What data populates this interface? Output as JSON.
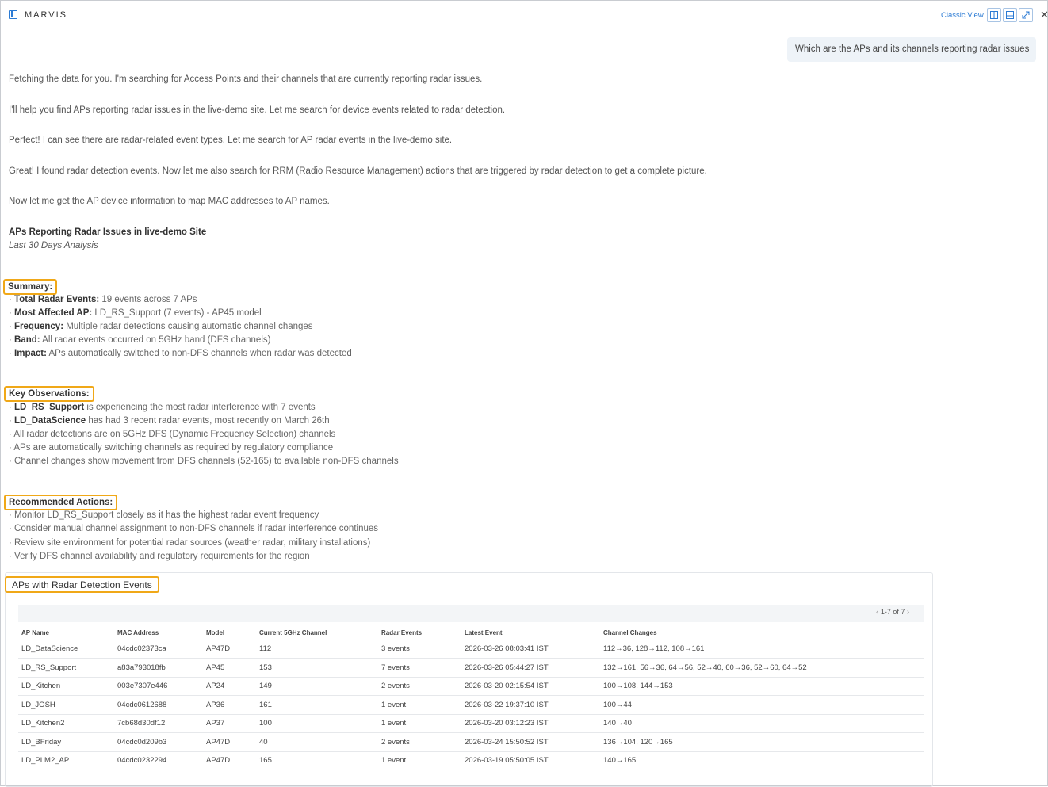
{
  "header": {
    "brand": "MARVIS",
    "classic_view": "Classic View"
  },
  "user_message": "Which are the APs and its channels reporting radar issues",
  "paragraphs": [
    "Fetching the data for you. I'm searching for Access Points and their channels that are currently reporting radar issues.",
    "I'll help you find APs reporting radar issues in the live-demo site. Let me search for device events related to radar detection.",
    "Perfect! I can see there are radar-related event types. Let me search for AP radar events in the live-demo site.",
    "Great! I found radar detection events. Now let me also search for RRM (Radio Resource Management) actions that are triggered by radar detection to get a complete picture.",
    "Now let me get the AP device information to map MAC addresses to AP names."
  ],
  "report": {
    "title": "APs Reporting Radar Issues in live-demo Site",
    "subtitle": "Last 30 Days Analysis"
  },
  "summary": {
    "title": "Summary:",
    "items": [
      {
        "label": "Total Radar Events:",
        "text": " 19 events across 7 APs"
      },
      {
        "label": "Most Affected AP:",
        "text": " LD_RS_Support (7 events) - AP45 model"
      },
      {
        "label": "Frequency:",
        "text": " Multiple radar detections causing automatic channel changes"
      },
      {
        "label": "Band:",
        "text": " All radar events occurred on 5GHz band (DFS channels)"
      },
      {
        "label": "Impact:",
        "text": " APs automatically switched to non-DFS channels when radar was detected"
      }
    ]
  },
  "observations": {
    "title": "Key Observations:",
    "items": [
      {
        "label": "LD_RS_Support",
        "text": " is experiencing the most radar interference with 7 events"
      },
      {
        "label": "LD_DataScience",
        "text": " has had 3 recent radar events, most recently on March 26th"
      },
      {
        "label": "",
        "text": "All radar detections are on 5GHz DFS (Dynamic Frequency Selection) channels"
      },
      {
        "label": "",
        "text": "APs are automatically switching channels as required by regulatory compliance"
      },
      {
        "label": "",
        "text": "Channel changes show movement from DFS channels (52-165) to available non-DFS channels"
      }
    ]
  },
  "actions": {
    "title": "Recommended Actions:",
    "items": [
      "Monitor LD_RS_Support closely as it has the highest radar event frequency",
      "Consider manual channel assignment to non-DFS channels if radar interference continues",
      "Review site environment for potential radar sources (weather radar, military installations)",
      "Verify DFS channel availability and regulatory requirements for the region"
    ]
  },
  "table": {
    "title": "APs with Radar Detection Events",
    "pager": "1-7 of 7",
    "columns": [
      "AP Name",
      "MAC Address",
      "Model",
      "Current 5GHz Channel",
      "Radar Events",
      "Latest Event",
      "Channel Changes"
    ],
    "rows": [
      [
        "LD_DataScience",
        "04cdc02373ca",
        "AP47D",
        "112",
        "3 events",
        "2026-03-26 08:03:41 IST",
        "112→36, 128→112, 108→161"
      ],
      [
        "LD_RS_Support",
        "a83a793018fb",
        "AP45",
        "153",
        "7 events",
        "2026-03-26 05:44:27 IST",
        "132→161, 56→36, 64→56, 52→40, 60→36, 52→60, 64→52"
      ],
      [
        "LD_Kitchen",
        "003e7307e446",
        "AP24",
        "149",
        "2 events",
        "2026-03-20 02:15:54 IST",
        "100→108, 144→153"
      ],
      [
        "LD_JOSH",
        "04cdc0612688",
        "AP36",
        "161",
        "1 event",
        "2026-03-22 19:37:10 IST",
        "100→44"
      ],
      [
        "LD_Kitchen2",
        "7cb68d30df12",
        "AP37",
        "100",
        "1 event",
        "2026-03-20 03:12:23 IST",
        "140→40"
      ],
      [
        "LD_BFriday",
        "04cdc0d209b3",
        "AP47D",
        "40",
        "2 events",
        "2026-03-24 15:50:52 IST",
        "136→104, 120→165"
      ],
      [
        "LD_PLM2_AP",
        "04cdc0232294",
        "AP47D",
        "165",
        "1 event",
        "2026-03-19 05:50:05 IST",
        "140→165"
      ]
    ]
  }
}
